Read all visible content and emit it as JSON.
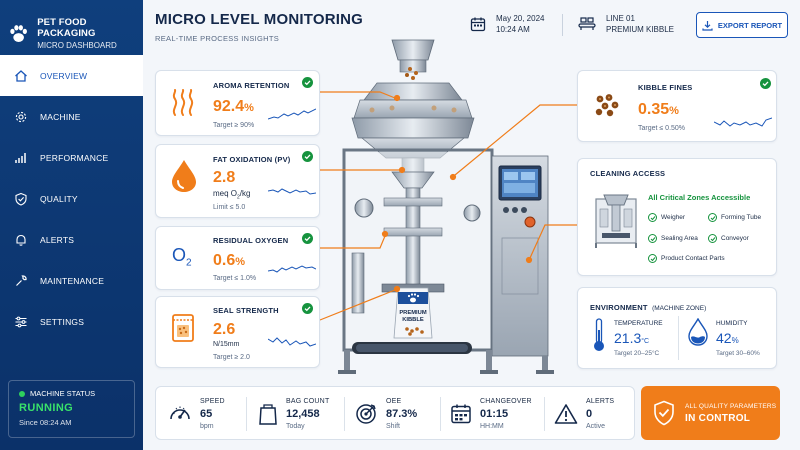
{
  "brand": {
    "title": "PET FOOD PACKAGING",
    "subtitle": "MICRO DASHBOARD"
  },
  "nav": [
    {
      "label": "OVERVIEW",
      "icon": "home-icon",
      "active": true
    },
    {
      "label": "MACHINE",
      "icon": "gear-icon"
    },
    {
      "label": "PERFORMANCE",
      "icon": "bar-chart-icon"
    },
    {
      "label": "QUALITY",
      "icon": "shield-check-icon"
    },
    {
      "label": "ALERTS",
      "icon": "bell-icon"
    },
    {
      "label": "MAINTENANCE",
      "icon": "wrench-icon"
    },
    {
      "label": "SETTINGS",
      "icon": "sliders-icon"
    }
  ],
  "machine_status": {
    "label": "MACHINE STATUS",
    "value": "RUNNING",
    "since": "Since 08:24 AM"
  },
  "header": {
    "title": "MICRO LEVEL MONITORING",
    "subtitle": "REAL-TIME PROCESS INSIGHTS",
    "date": "May 20, 2024",
    "time": "10:24 AM",
    "line": "LINE 01",
    "product": "PREMIUM KIBBLE",
    "export_label": "EXPORT REPORT"
  },
  "metrics": {
    "aroma": {
      "title": "AROMA RETENTION",
      "value": "92.4",
      "unit": "%",
      "target": "Target ≥ 90%"
    },
    "oxidation": {
      "title": "FAT OXIDATION (PV)",
      "value": "2.8",
      "unit_prefix": "meq O",
      "unit_sub": "2",
      "unit_suffix": "/kg",
      "target": "Limit ≤ 5.0"
    },
    "oxygen": {
      "title": "RESIDUAL OXYGEN",
      "value": "0.6",
      "unit": "%",
      "target": "Target ≤ 1.0%",
      "icon_text": "O",
      "icon_sub": "2"
    },
    "seal": {
      "title": "SEAL STRENGTH",
      "value": "2.6",
      "unit": "N/15mm",
      "target": "Target ≥ 2.0"
    },
    "fines": {
      "title": "KIBBLE FINES",
      "value": "0.35",
      "unit": "%",
      "target": "Target ≤ 0.50%"
    }
  },
  "bag": {
    "line1": "PREMIUM",
    "line2": "KIBBLE"
  },
  "cleaning": {
    "title": "CLEANING ACCESS",
    "headline": "All Critical Zones Accessible",
    "items": [
      "Weigher",
      "Forming Tube",
      "Sealing Area",
      "Conveyor",
      "Product Contact Parts"
    ]
  },
  "environment": {
    "title": "ENVIRONMENT",
    "title_suffix": "(MACHINE ZONE)",
    "temp_label": "TEMPERATURE",
    "temp_value": "21.3",
    "temp_unit": "°C",
    "temp_target": "Target 20–25°C",
    "hum_label": "HUMIDITY",
    "hum_value": "42",
    "hum_unit": "%",
    "hum_target": "Target 30–60%"
  },
  "kpis": [
    {
      "label": "SPEED",
      "value": "65",
      "unit": "bpm"
    },
    {
      "label": "BAG COUNT",
      "value": "12,458",
      "unit": "Today"
    },
    {
      "label": "OEE",
      "value": "87.3%",
      "unit": "Shift"
    },
    {
      "label": "CHANGEOVER",
      "value": "01:15",
      "unit": "HH:MM"
    },
    {
      "label": "ALERTS",
      "value": "0",
      "unit": "Active"
    }
  ],
  "control": {
    "line1": "ALL QUALITY PARAMETERS",
    "line2": "IN CONTROL"
  },
  "colors": {
    "sidebar": "#0f3f7d",
    "accent": "#f07d1a",
    "primary": "#1a56b8",
    "ok": "#16933e",
    "running": "#39e06a"
  }
}
